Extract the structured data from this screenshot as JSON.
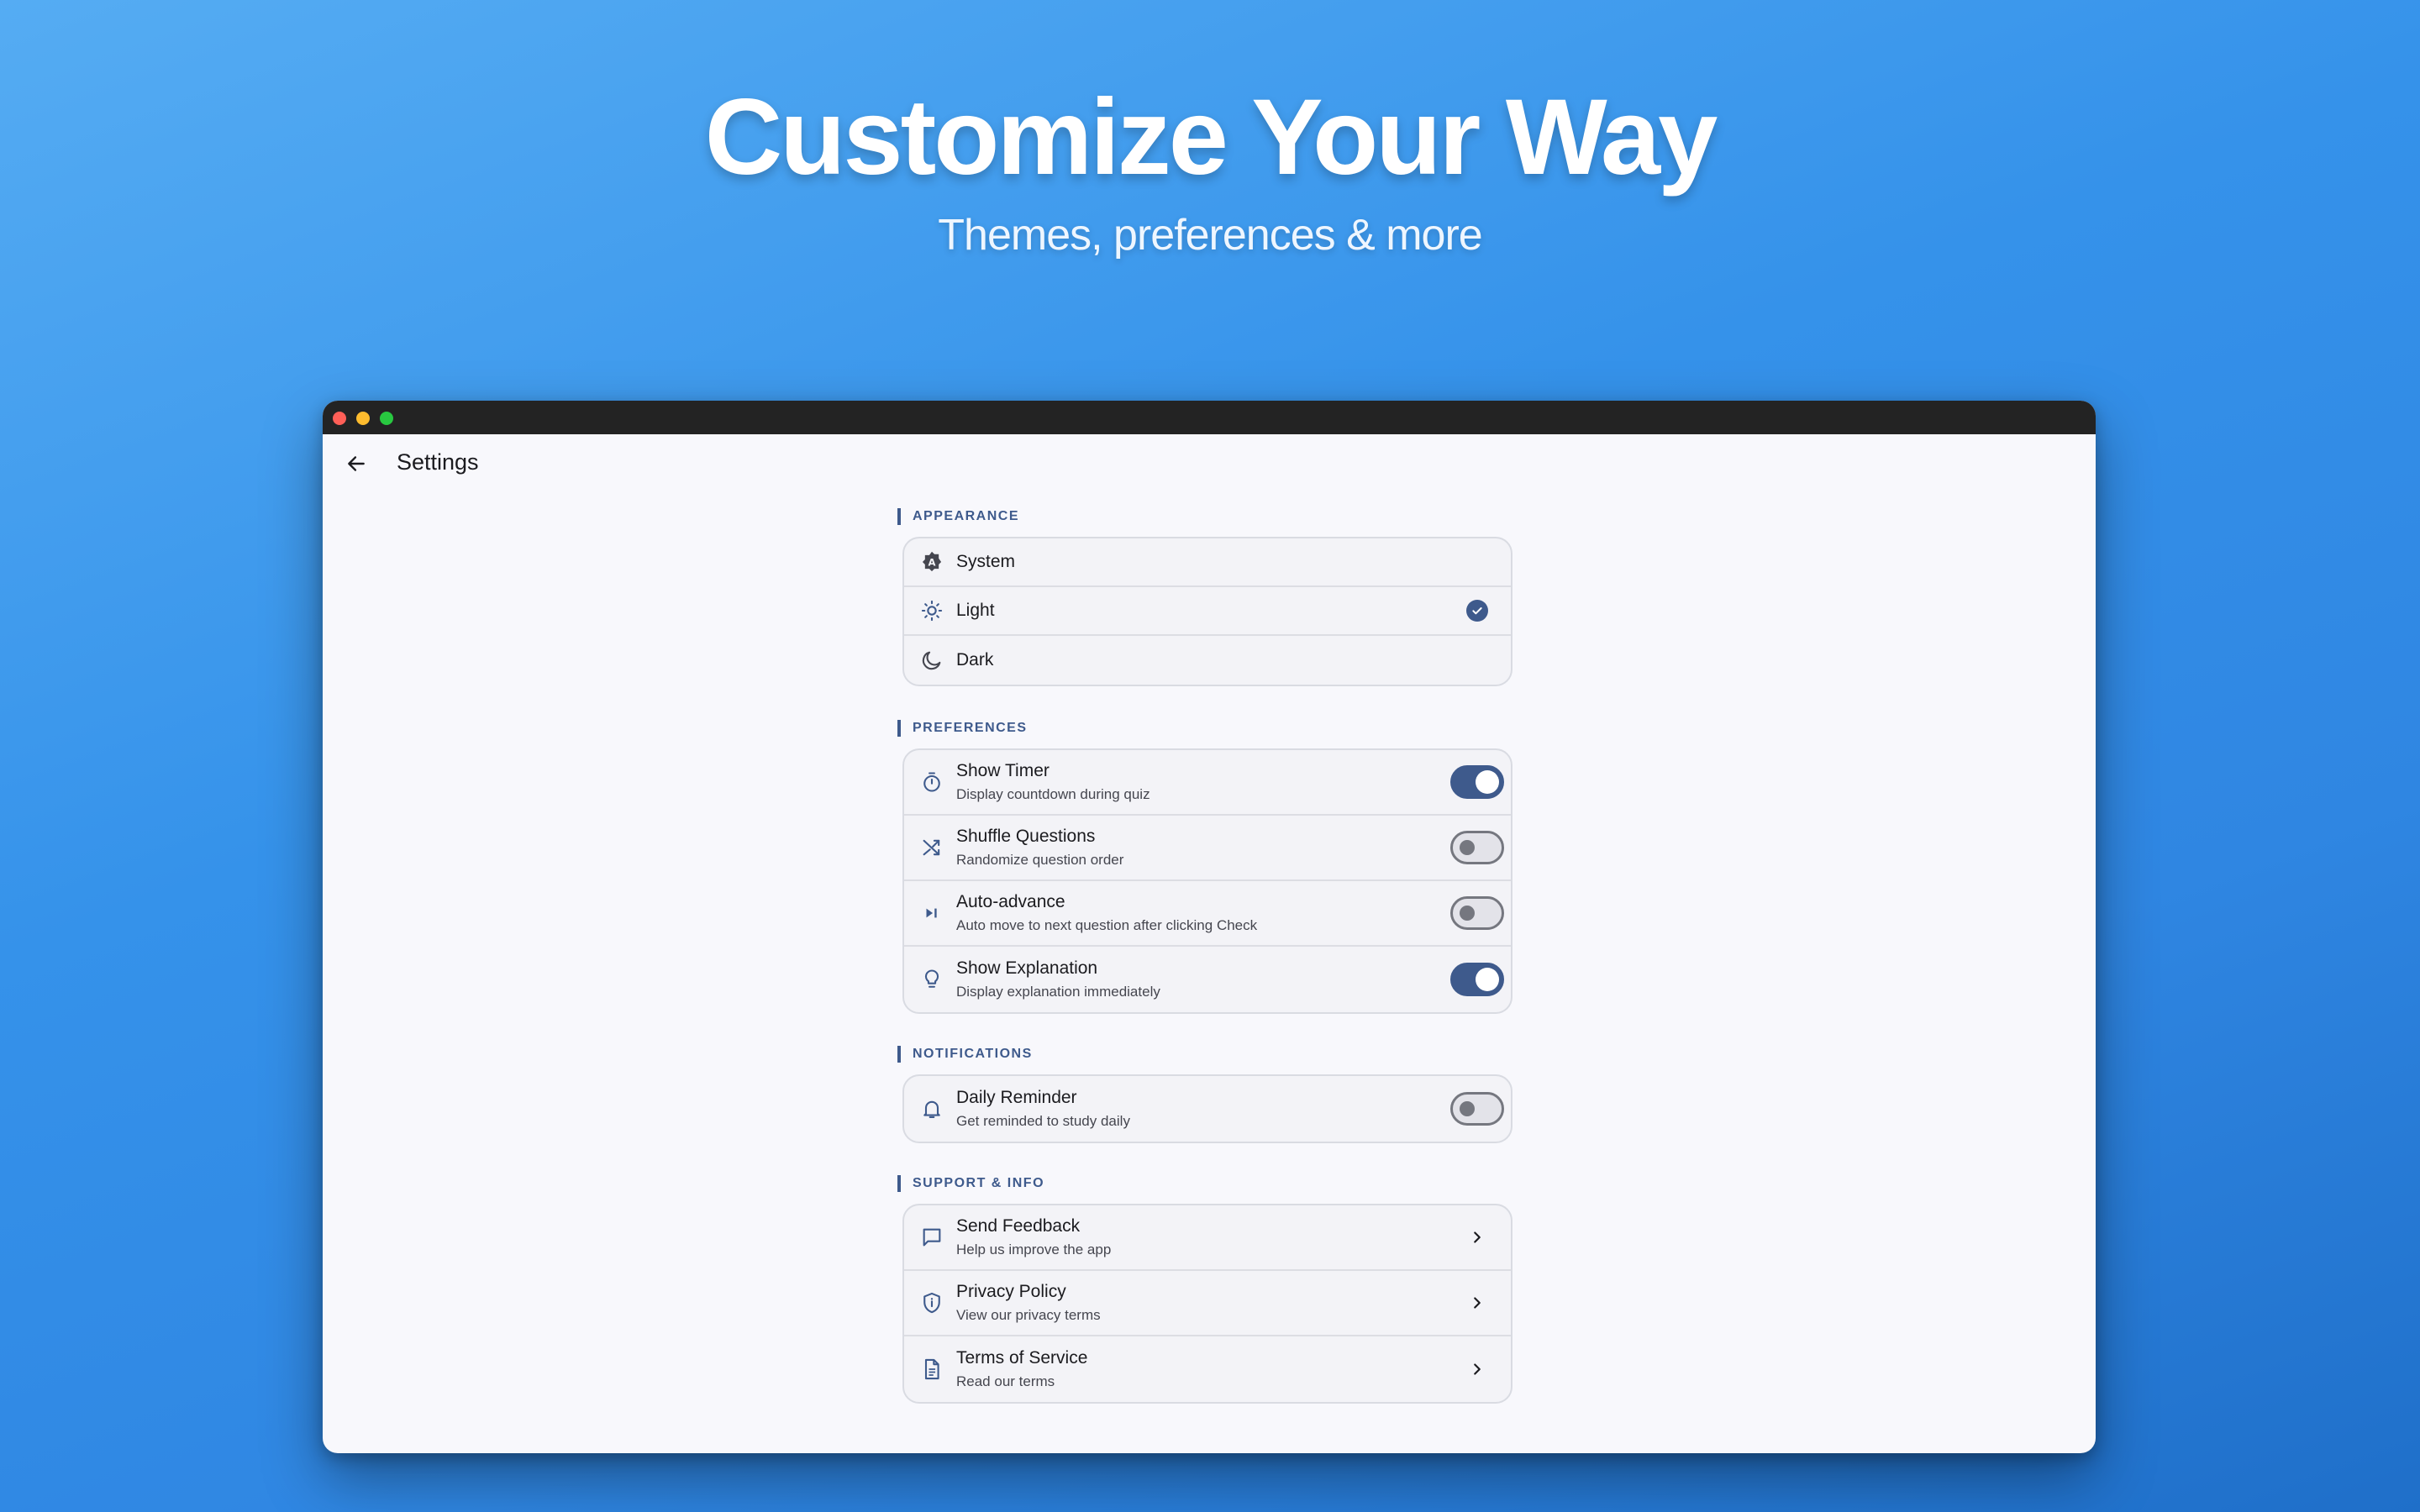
{
  "hero": {
    "title": "Customize Your Way",
    "subtitle": "Themes, preferences & more"
  },
  "appbar": {
    "back_icon": "arrow-left-icon",
    "title": "Settings"
  },
  "sections": {
    "appearance": {
      "header": "APPEARANCE",
      "items": [
        {
          "label": "System",
          "icon": "auto-brightness-icon",
          "selected": false
        },
        {
          "label": "Light",
          "icon": "sun-icon",
          "selected": true
        },
        {
          "label": "Dark",
          "icon": "moon-icon",
          "selected": false
        }
      ]
    },
    "preferences": {
      "header": "PREFERENCES",
      "items": [
        {
          "title": "Show Timer",
          "subtitle": "Display countdown during quiz",
          "icon": "timer-icon",
          "enabled": true
        },
        {
          "title": "Shuffle Questions",
          "subtitle": "Randomize question order",
          "icon": "shuffle-icon",
          "enabled": false
        },
        {
          "title": "Auto-advance",
          "subtitle": "Auto move to next question after clicking Check",
          "icon": "skip-next-icon",
          "enabled": false
        },
        {
          "title": "Show Explanation",
          "subtitle": "Display explanation immediately",
          "icon": "lightbulb-icon",
          "enabled": true
        }
      ]
    },
    "notifications": {
      "header": "NOTIFICATIONS",
      "items": [
        {
          "title": "Daily Reminder",
          "subtitle": "Get reminded to study daily",
          "icon": "bell-icon",
          "enabled": false
        }
      ]
    },
    "support": {
      "header": "SUPPORT & INFO",
      "items": [
        {
          "title": "Send Feedback",
          "subtitle": "Help us improve the app",
          "icon": "feedback-icon"
        },
        {
          "title": "Privacy Policy",
          "subtitle": "View our privacy terms",
          "icon": "shield-icon"
        },
        {
          "title": "Terms of Service",
          "subtitle": "Read our terms",
          "icon": "document-icon"
        }
      ]
    }
  },
  "colors": {
    "accent": "#3e5a8c",
    "background_gradient_start": "#55acf3",
    "background_gradient_end": "#1f6fc9"
  }
}
